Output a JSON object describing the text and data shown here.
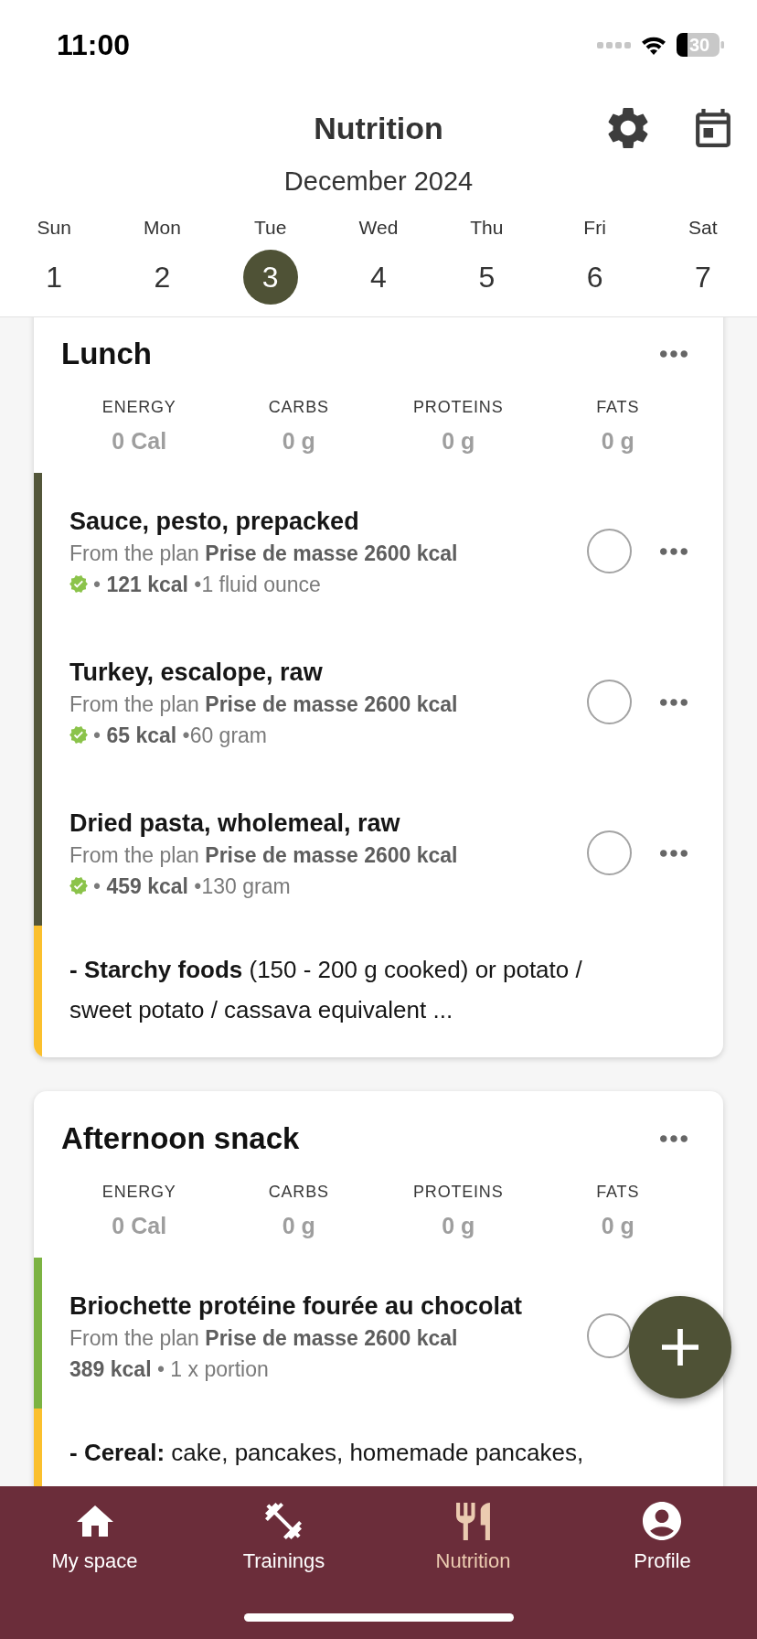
{
  "status_bar": {
    "time": "11:00",
    "battery": "30"
  },
  "header": {
    "title": "Nutrition",
    "month": "December 2024"
  },
  "days": [
    {
      "weekday": "Sun",
      "day": "1",
      "selected": false
    },
    {
      "weekday": "Mon",
      "day": "2",
      "selected": false
    },
    {
      "weekday": "Tue",
      "day": "3",
      "selected": true
    },
    {
      "weekday": "Wed",
      "day": "4",
      "selected": false
    },
    {
      "weekday": "Thu",
      "day": "5",
      "selected": false
    },
    {
      "weekday": "Fri",
      "day": "6",
      "selected": false
    },
    {
      "weekday": "Sat",
      "day": "7",
      "selected": false
    }
  ],
  "meals": [
    {
      "title": "Lunch",
      "nutrients": [
        {
          "label": "ENERGY",
          "value": "0 Cal"
        },
        {
          "label": "CARBS",
          "value": "0 g"
        },
        {
          "label": "PROTEINS",
          "value": "0 g"
        },
        {
          "label": "FATS",
          "value": "0 g"
        }
      ],
      "items": [
        {
          "kind": "food",
          "color": "#53563a",
          "name": "Sauce, pesto, prepacked",
          "plan": "From the plan **Prise de masse 2600 kcal**",
          "verified": true,
          "details": "• **121 kcal** •1 fluid ounce",
          "checked": false
        },
        {
          "kind": "food",
          "color": "#53563a",
          "name": "Turkey, escalope, raw",
          "plan": "From the plan **Prise de masse 2600 kcal**",
          "verified": true,
          "details": "• **65 kcal** •60 gram",
          "checked": false
        },
        {
          "kind": "food",
          "color": "#53563a",
          "name": "Dried pasta, wholemeal, raw",
          "plan": "From the plan **Prise de masse 2600 kcal**",
          "verified": true,
          "details": "• **459 kcal** •130 gram",
          "checked": false
        },
        {
          "kind": "note",
          "color": "#fbc02d",
          "text": "**- Starchy foods** (150 - 200 g cooked) or potato / sweet potato / cassava equivalent ..."
        }
      ]
    },
    {
      "title": "Afternoon snack",
      "nutrients": [
        {
          "label": "ENERGY",
          "value": "0 Cal"
        },
        {
          "label": "CARBS",
          "value": "0 g"
        },
        {
          "label": "PROTEINS",
          "value": "0 g"
        },
        {
          "label": "FATS",
          "value": "0 g"
        }
      ],
      "items": [
        {
          "kind": "food",
          "color": "#7cb342",
          "name": "Briochette protéine fourée au chocolat",
          "plan": "From the plan **Prise de masse 2600 kcal**",
          "verified": false,
          "details": "**389 kcal** • 1 x portion",
          "checked": false
        },
        {
          "kind": "note",
          "color": "#fbc02d",
          "text": "**- Cereal:** cake, pancakes, homemade pancakes,"
        }
      ]
    }
  ],
  "nav": [
    {
      "label": "My space",
      "selected": false
    },
    {
      "label": "Trainings",
      "selected": false
    },
    {
      "label": "Nutrition",
      "selected": true
    },
    {
      "label": "Profile",
      "selected": false
    }
  ]
}
